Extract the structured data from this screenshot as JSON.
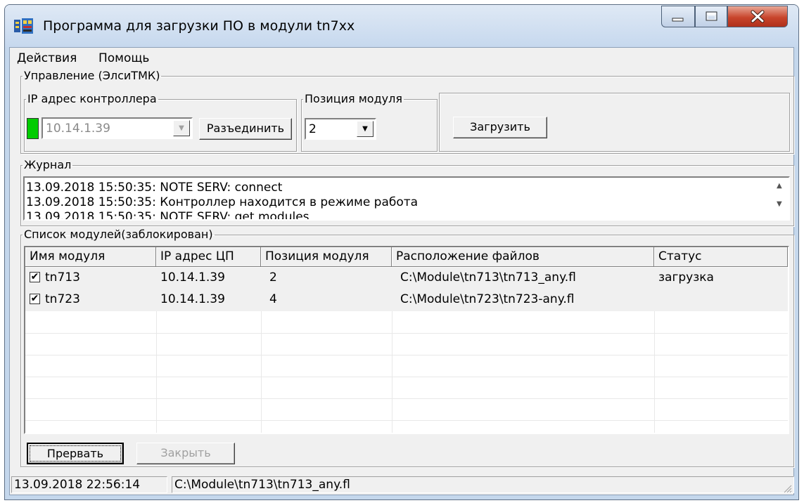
{
  "window": {
    "title": "Программа для загрузки ПО в модули tn7xx",
    "controls": {
      "minimize": "minimize-icon",
      "maximize": "maximize-icon",
      "close": "close-icon"
    }
  },
  "menu": {
    "items": [
      "Действия",
      "Помощь"
    ]
  },
  "control_group": {
    "legend": "Управление (ЭлсиТМК)",
    "ip": {
      "legend": "IP адрес контроллера",
      "value": "10.14.1.39",
      "indicator_color": "#00cc00",
      "disconnect_label": "Разъединить"
    },
    "position": {
      "legend": "Позиция модуля",
      "value": "2"
    },
    "upload_label": "Загрузить"
  },
  "journal": {
    "legend": "Журнал",
    "lines": [
      "13.09.2018 15:50:35: NOTE SERV: connect",
      "13.09.2018 15:50:35: Контроллер находится в режиме работа",
      "13.09.2018 15:50:35: NOTE SERV: get modules"
    ]
  },
  "modules": {
    "legend": "Список модулей(заблокирован)",
    "columns": [
      "Имя модуля",
      "IP адрес ЦП",
      "Позиция модуля",
      "Расположение файлов",
      "Статус"
    ],
    "rows": [
      {
        "checked": true,
        "name": "tn713",
        "ip": "10.14.1.39",
        "position": "2",
        "path": "C:\\Module\\tn713\\tn713_any.fl",
        "status": "загрузка"
      },
      {
        "checked": true,
        "name": "tn723",
        "ip": "10.14.1.39",
        "position": "4",
        "path": "C:\\Module\\tn723\\tn723-any.fl",
        "status": ""
      }
    ]
  },
  "buttons": {
    "abort": "Прервать",
    "close": "Закрыть"
  },
  "statusbar": {
    "time": "13.09.2018 22:56:14",
    "file": "C:\\Module\\tn713\\tn713_any.fl"
  }
}
